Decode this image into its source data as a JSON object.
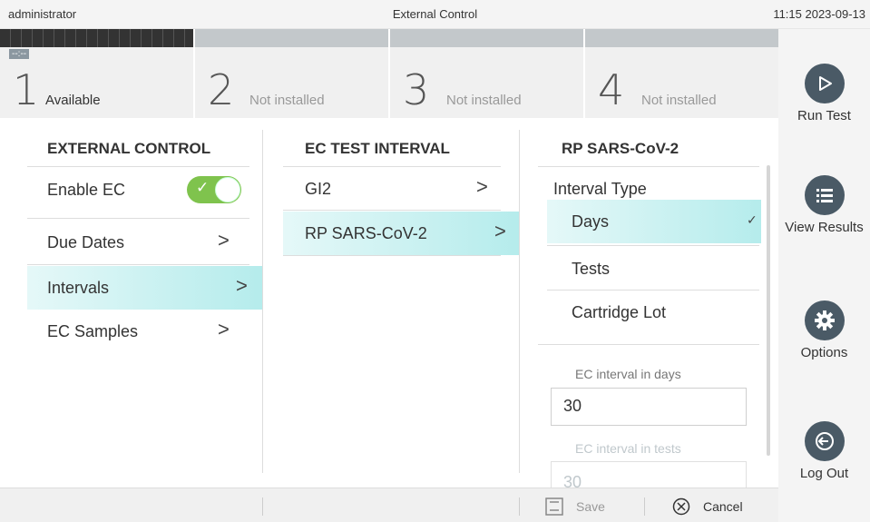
{
  "topbar": {
    "user": "administrator",
    "title": "External Control",
    "clock": "11:15 2023-09-13"
  },
  "modules": [
    {
      "number": "1",
      "status": "Available",
      "time": "--:--"
    },
    {
      "number": "2",
      "status": "Not installed"
    },
    {
      "number": "3",
      "status": "Not installed"
    },
    {
      "number": "4",
      "status": "Not installed"
    }
  ],
  "sidebar": {
    "run_test": "Run Test",
    "view_results": "View Results",
    "options": "Options",
    "log_out": "Log Out"
  },
  "col1": {
    "title": "EXTERNAL CONTROL",
    "items": [
      "Enable EC",
      "Due Dates",
      "Intervals",
      "EC Samples"
    ],
    "enable_ec_on": true,
    "selected": "Intervals"
  },
  "col2": {
    "title": "EC TEST INTERVAL",
    "items": [
      "GI2",
      "RP SARS-CoV-2"
    ],
    "selected": "RP SARS-CoV-2"
  },
  "col3": {
    "title": "RP SARS-CoV-2",
    "interval_type_label": "Interval Type",
    "options": [
      "Days",
      "Tests",
      "Cartridge Lot"
    ],
    "selected": "Days",
    "days_label": "EC interval in days",
    "days_value": "30",
    "tests_label": "EC interval in tests",
    "tests_value": "30"
  },
  "bottom": {
    "save": "Save",
    "cancel": "Cancel"
  },
  "colors": {
    "accent": "#b5ecec",
    "toggle_on": "#7fc34d",
    "sidebar_icon": "#4a5a66"
  }
}
